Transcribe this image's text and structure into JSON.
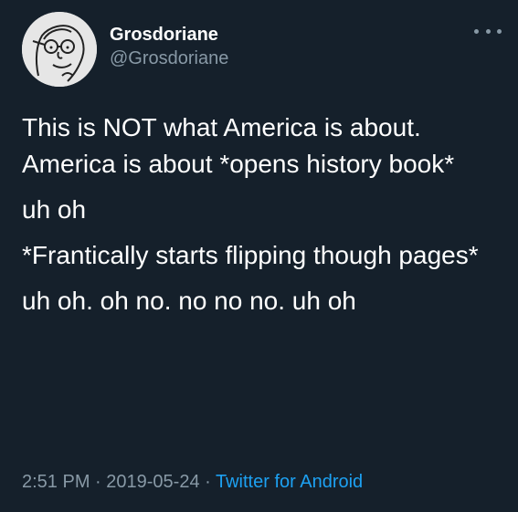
{
  "user": {
    "display_name": "Grosdoriane",
    "handle": "@Grosdoriane"
  },
  "tweet": {
    "paragraphs": [
      "This is NOT what America is about. America is about *opens history book*",
      "uh oh",
      "*Frantically starts flipping though pages*",
      "uh oh. oh no. no no no. uh oh"
    ]
  },
  "meta": {
    "time": "2:51 PM",
    "separator": " · ",
    "date": "2019-05-24",
    "source": "Twitter for Android"
  },
  "icons": {
    "more": "more-options-icon",
    "avatar": "cartoon-face-avatar"
  },
  "colors": {
    "background": "#15202b",
    "text": "#ffffff",
    "secondary_text": "#8899a6",
    "link": "#1da1f2"
  }
}
